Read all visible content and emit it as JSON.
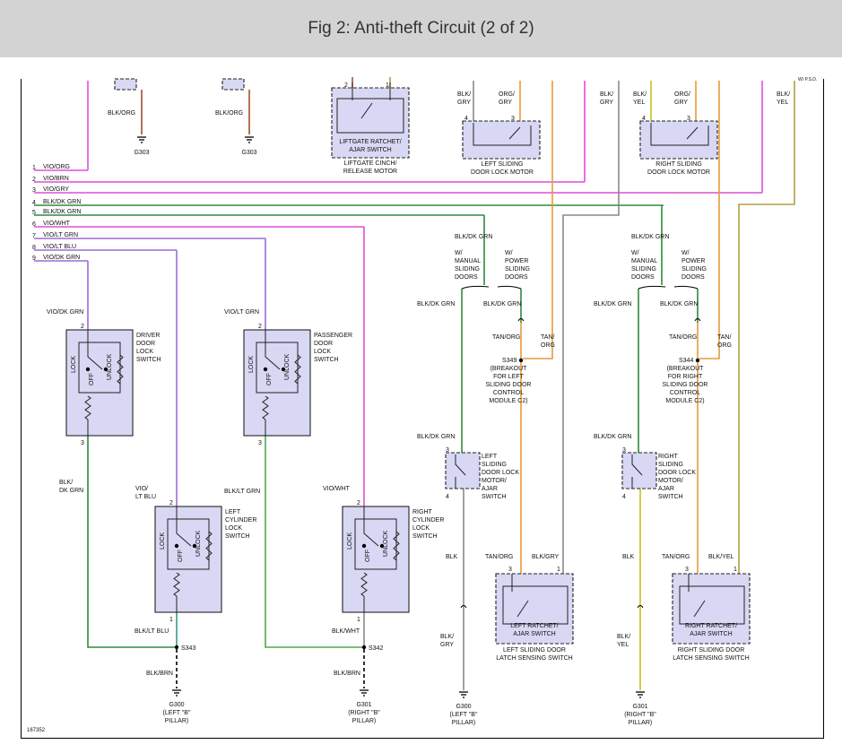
{
  "header": {
    "title": "Fig 2: Anti-theft Circuit (2 of 2)"
  },
  "colors": {
    "vio": "#e04fd8",
    "vio_brn": "#e04fd8",
    "green": "#2e8b3a",
    "lt_green": "#4fa84f",
    "purple": "#9b6bd8",
    "orange": "#e89a3a",
    "gray": "#8a8a8a",
    "yellow": "#c8c020",
    "olive": "#b0a040",
    "brown": "#a0522d",
    "teal": "#3a9a8a",
    "component_fill": "#d8d8f4"
  },
  "fig_number": "167352",
  "bus": {
    "numbers": [
      "1",
      "2",
      "3",
      "4",
      "5",
      "6",
      "7",
      "8",
      "9"
    ],
    "labels": [
      "VIO/ORG",
      "VIO/BRN",
      "VIO/GRY",
      "BLK/DK GRN",
      "BLK/DK GRN",
      "VIO/WHT",
      "VIO/LT GRN",
      "VIO/LT BLU",
      "VIO/DK GRN"
    ]
  },
  "top": {
    "g303a_wire": "BLK/ORG",
    "g303a": "G303",
    "g303b_wire": "BLK/ORG",
    "g303b": "G303",
    "liftgate_switch": "LIFTGATE RATCHET/\nAJAR SWITCH",
    "liftgate_motor": "LIFTGATE CINCH/\nRELEASE MOTOR",
    "lg_pin2": "2",
    "lg_pin1": "1",
    "lsd_wire1": "BLK/\nGRY",
    "lsd_wire2": "ORG/\nGRY",
    "lsd_pin4": "4",
    "lsd_pin3": "3",
    "lsd_motor": "LEFT SLIDING\nDOOR LOCK MOTOR",
    "blk_gry_top": "BLK/\nGRY",
    "rsd_wire1": "BLK/\nYEL",
    "rsd_wire2": "ORG/\nGRY",
    "rsd_pin4": "4",
    "rsd_pin3": "3",
    "rsd_motor": "RIGHT SLIDING\nDOOR LOCK MOTOR",
    "blk_yel_top": "BLK/\nYEL",
    "corner_text": "W/ P.S.D."
  },
  "left_branch": {
    "blk_dk_grn": "BLK/DK GRN",
    "manual": "W/\nMANUAL\nSLIDING\nDOORS",
    "power": "W/\nPOWER\nSLIDING\nDOORS",
    "wire_a": "BLK/DK GRN",
    "wire_b": "BLK/DK GRN",
    "tan_org": "TAN/ORG",
    "org": "TAN/\nORG",
    "splice": "S349",
    "breakout": "(BREAKOUT\nFOR LEFT\nSLIDING DOOR\nCONTROL\nMODULE C2)",
    "wire_c": "BLK/DK GRN",
    "switch": "LEFT\nSLIDING\nDOOR LOCK\nMOTOR/\nAJAR\nSWITCH",
    "pin3": "3",
    "pin4": "4",
    "blk": "BLK",
    "tan_org2": "TAN/ORG",
    "blk_gry": "BLK/GRY",
    "p3": "3",
    "p1": "1",
    "ratchet": "LEFT RATCHET/\nAJAR SWITCH",
    "ratchet_caption": "LEFT SLIDING DOOR\nLATCH SENSING SWITCH",
    "blk_gry2": "BLK/\nGRY",
    "ground": "G300\n(LEFT \"B\"\nPILLAR)"
  },
  "right_branch": {
    "blk_dk_grn": "BLK/DK GRN",
    "manual": "W/\nMANUAL\nSLIDING\nDOORS",
    "power": "W/\nPOWER\nSLIDING\nDOORS",
    "wire_a": "BLK/DK GRN",
    "wire_b": "BLK/DK GRN",
    "tan_org": "TAN/ORG",
    "org": "TAN/\nORG",
    "splice": "S344",
    "breakout": "(BREAKOUT\nFOR RIGHT\nSLIDING DOOR\nCONTROL\nMODULE C2)",
    "wire_c": "BLK/DK GRN",
    "switch": "RIGHT\nSLIDING\nDOOR LOCK\nMOTOR/\nAJAR\nSWITCH",
    "pin3": "3",
    "pin4": "4",
    "blk": "BLK",
    "tan_org2": "TAN/ORG",
    "blk_yel": "BLK/YEL",
    "p3": "3",
    "p1": "1",
    "ratchet": "RIGHT RATCHET/\nAJAR SWITCH",
    "ratchet_caption": "RIGHT SLIDING DOOR\nLATCH SENSING SWITCH",
    "blk_yel2": "BLK/\nYEL",
    "ground": "G301\n(RIGHT \"B\"\nPILLAR)"
  },
  "switches": {
    "driver": {
      "wire_in": "VIO/DK GRN",
      "pin2": "2",
      "pin3": "3",
      "name": "DRIVER\nDOOR\nLOCK\nSWITCH",
      "lock": "LOCK",
      "off": "OFF",
      "unlock": "UNLOCK",
      "wire_out": "BLK/\nDK GRN"
    },
    "passenger": {
      "wire_in": "VIO/LT GRN",
      "pin2": "2",
      "pin3": "3",
      "name": "PASSENGER\nDOOR\nLOCK\nSWITCH",
      "lock": "LOCK",
      "off": "OFF",
      "unlock": "UNLOCK",
      "wire_out": "BLK/LT GRN"
    },
    "left_cyl": {
      "wire_in": "VIO/\nLT BLU",
      "pin2": "2",
      "pin1": "1",
      "name": "LEFT\nCYLINDER\nLOCK\nSWITCH",
      "lock": "LOCK",
      "off": "OFF",
      "unlock": "UNLOCK",
      "wire_out": "BLK/LT BLU"
    },
    "right_cyl": {
      "wire_in": "VIO/WHT",
      "pin2": "2",
      "pin1": "1",
      "name": "RIGHT\nCYLINDER\nLOCK\nSWITCH",
      "lock": "LOCK",
      "off": "OFF",
      "unlock": "UNLOCK",
      "wire_out": "BLK/WHT"
    }
  },
  "bottom": {
    "s343": "S343",
    "blk_brn_l": "BLK/BRN",
    "g300": "G300\n(LEFT \"B\"\nPILLAR)",
    "s342": "S342",
    "blk_brn_r": "BLK/BRN",
    "g301": "G301\n(RIGHT \"B\"\nPILLAR)"
  }
}
